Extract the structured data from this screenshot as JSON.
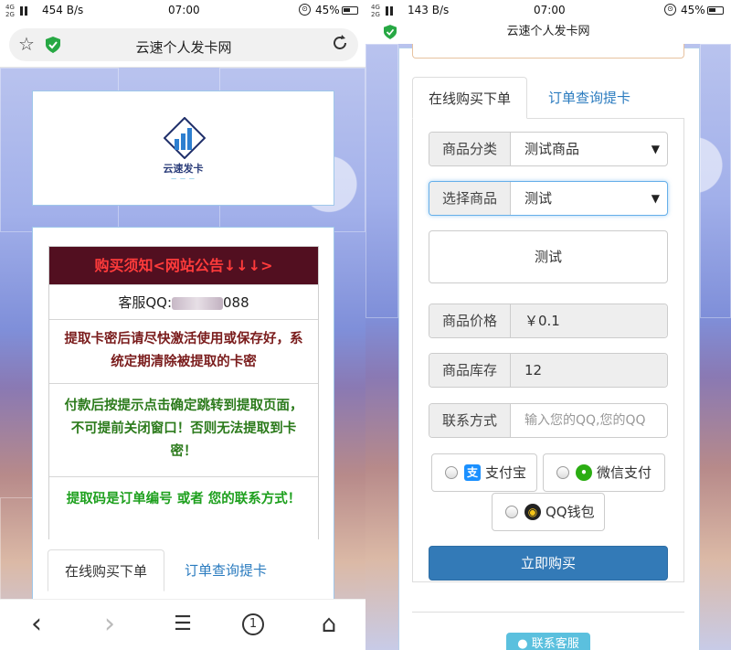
{
  "colors": {
    "accent": "#337ab7",
    "tab_link": "#2a7bbf",
    "notice_head_bg": "#520f20",
    "notice_head_text": "#ff3b3b",
    "notice_red": "#7a1c1c",
    "notice_green": "#2b7a1b",
    "notice_bright_green": "#1ea01e",
    "alipay": "#1a90ff",
    "wechat": "#2bad13",
    "kefu_button": "#5bc0de"
  },
  "left": {
    "status": {
      "speed": "454 B/s",
      "time": "07:00",
      "battery": "45%"
    },
    "browser": {
      "title": "云速个人发卡网",
      "icons": [
        "star-icon",
        "shield-icon",
        "reload-icon"
      ]
    },
    "logo": {
      "text": "云速发卡"
    },
    "notice": {
      "heading": "购买须知<网站公告↓↓↓>",
      "qq_prefix": "客服QQ:",
      "qq_suffix": "088",
      "line1": "提取卡密后请尽快激活使用或保存好，系统定期清除被提取的卡密",
      "line2": "付款后按提示点击确定跳转到提取页面，不可提前关闭窗口！否则无法提取到卡密！",
      "line3": "提取码是订单编号 或者 您的联系方式！"
    },
    "tabs": {
      "buy": "在线购买下单",
      "query": "订单查询提卡"
    },
    "nav": {
      "back": "‹",
      "forward": "›",
      "menu": "☰",
      "tabs_count": "1",
      "home": "⌂"
    }
  },
  "right": {
    "status": {
      "speed": "143 B/s",
      "time": "07:00",
      "battery": "45%"
    },
    "title": "云速个人发卡网",
    "tabs": {
      "buy": "在线购买下单",
      "query": "订单查询提卡"
    },
    "form": {
      "category_label": "商品分类",
      "category_value": "测试商品",
      "product_label": "选择商品",
      "product_value": "测试",
      "description": "测试",
      "price_label": "商品价格",
      "price_value": "￥0.1",
      "stock_label": "商品库存",
      "stock_value": "12",
      "contact_label": "联系方式",
      "contact_placeholder": "输入您的QQ,您的QQ"
    },
    "payment": {
      "alipay": "支付宝",
      "wechat": "微信支付",
      "qqwallet": "QQ钱包"
    },
    "buy_button": "立即购买",
    "contact_button": "联系客服"
  }
}
